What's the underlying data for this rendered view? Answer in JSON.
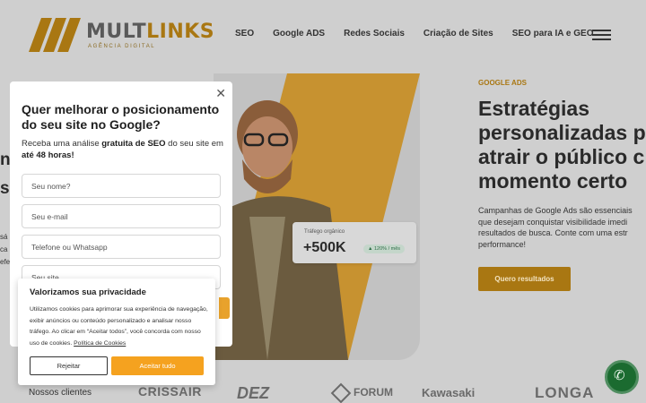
{
  "header": {
    "logo_text_main": "MULT",
    "logo_text_accent": "LINKS",
    "logo_sub": "AGÊNCIA DIGITAL",
    "nav": [
      "SEO",
      "Google ADS",
      "Redes Sociais",
      "Criação de Sites",
      "SEO para IA e GEO"
    ]
  },
  "hero": {
    "tag": "GOOGLE ADS",
    "title_lines": [
      "Estratégias",
      "personalizadas p",
      "atrair o público c",
      "momento certo"
    ],
    "desc_lines": [
      "Campanhas de Google Ads são essenciais",
      "que desejam conquistar visibilidade imedi",
      "resultados de busca. Conte com uma estr",
      "performance!"
    ],
    "cta": "Quero resultados",
    "stat": {
      "label": "Tráfego orgânico",
      "value": "+500K",
      "badge": "▲ 120% / mês"
    },
    "left_peek": [
      "n",
      "s"
    ],
    "left_peek_small": [
      "sá",
      "ca",
      "efe"
    ]
  },
  "clients": {
    "label": "Nossos clientes",
    "logos": [
      "CRISSAIR",
      "DEZ",
      "FORUM",
      "Kawasaki",
      "LONGA"
    ]
  },
  "modal": {
    "title": "Quer melhorar o posicionamento do seu site no Google?",
    "text_1": "Receba uma análise ",
    "text_bold_1": "gratuita de SEO",
    "text_2": " do seu site em ",
    "text_bold_2": "até 48 horas!",
    "fields": [
      "Seu nome?",
      "Seu e-mail",
      "Telefone ou Whatsapp",
      "Seu site"
    ]
  },
  "cookie": {
    "title": "Valorizamos sua privacidade",
    "text": "Utilizamos cookies para aprimorar sua experiência de navegação, exibir anúncios ou conteúdo personalizado e analisar nosso tráfego. Ao clicar em “Aceitar todos”, você concorda com nosso uso de cookies. ",
    "link": "Política de Cookies",
    "reject": "Rejeitar",
    "accept": "Aceitar tudo"
  },
  "colors": {
    "brand": "#a97712",
    "accent": "#f5a21f",
    "whatsapp": "#1b6b30"
  },
  "icons": {
    "close": "close-icon",
    "whatsapp": "whatsapp-icon",
    "menu": "hamburger-menu-icon"
  }
}
